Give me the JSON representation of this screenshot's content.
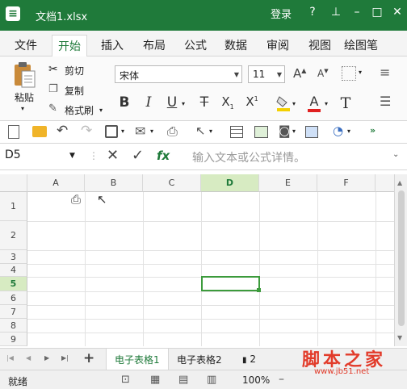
{
  "window": {
    "title": "文档1.xlsx",
    "login": "登录",
    "help": "?"
  },
  "menu": {
    "tabs": [
      "文件",
      "开始",
      "插入",
      "布局",
      "公式",
      "数据",
      "审阅",
      "视图",
      "绘图笔"
    ],
    "active_index": 1
  },
  "ribbon": {
    "paste": "粘贴",
    "cut": "剪切",
    "copy": "复制",
    "format_painter": "格式刷",
    "font_name": "宋体",
    "font_size": "11",
    "bold": "B",
    "italic": "I",
    "underline": "U",
    "strike": "T",
    "subscript": "X",
    "subscript_mark": "1",
    "superscript": "X",
    "superscript_mark": "1",
    "font_color_letter": "A",
    "clear_format": "T"
  },
  "formula_bar": {
    "name_box": "D5",
    "cancel": "✕",
    "confirm": "✓",
    "fx": "fx",
    "placeholder": "输入文本或公式详情。"
  },
  "sheet": {
    "columns": [
      "A",
      "B",
      "C",
      "D",
      "E",
      "F"
    ],
    "rows": [
      "1",
      "2",
      "3",
      "4",
      "5",
      "6",
      "7",
      "8",
      "9"
    ],
    "selected_col": "D",
    "selected_row": "5"
  },
  "tabs": {
    "add": "+",
    "sheets": [
      "电子表格1",
      "电子表格2"
    ],
    "more": "2"
  },
  "status": {
    "text": "就绪",
    "zoom": "100%"
  },
  "watermark": {
    "text": "脚本之家",
    "url": "www.jb51.net"
  },
  "colors": {
    "accent": "#1f7a3a",
    "selection": "#d7ebc2",
    "watermark": "#e23b2a"
  }
}
